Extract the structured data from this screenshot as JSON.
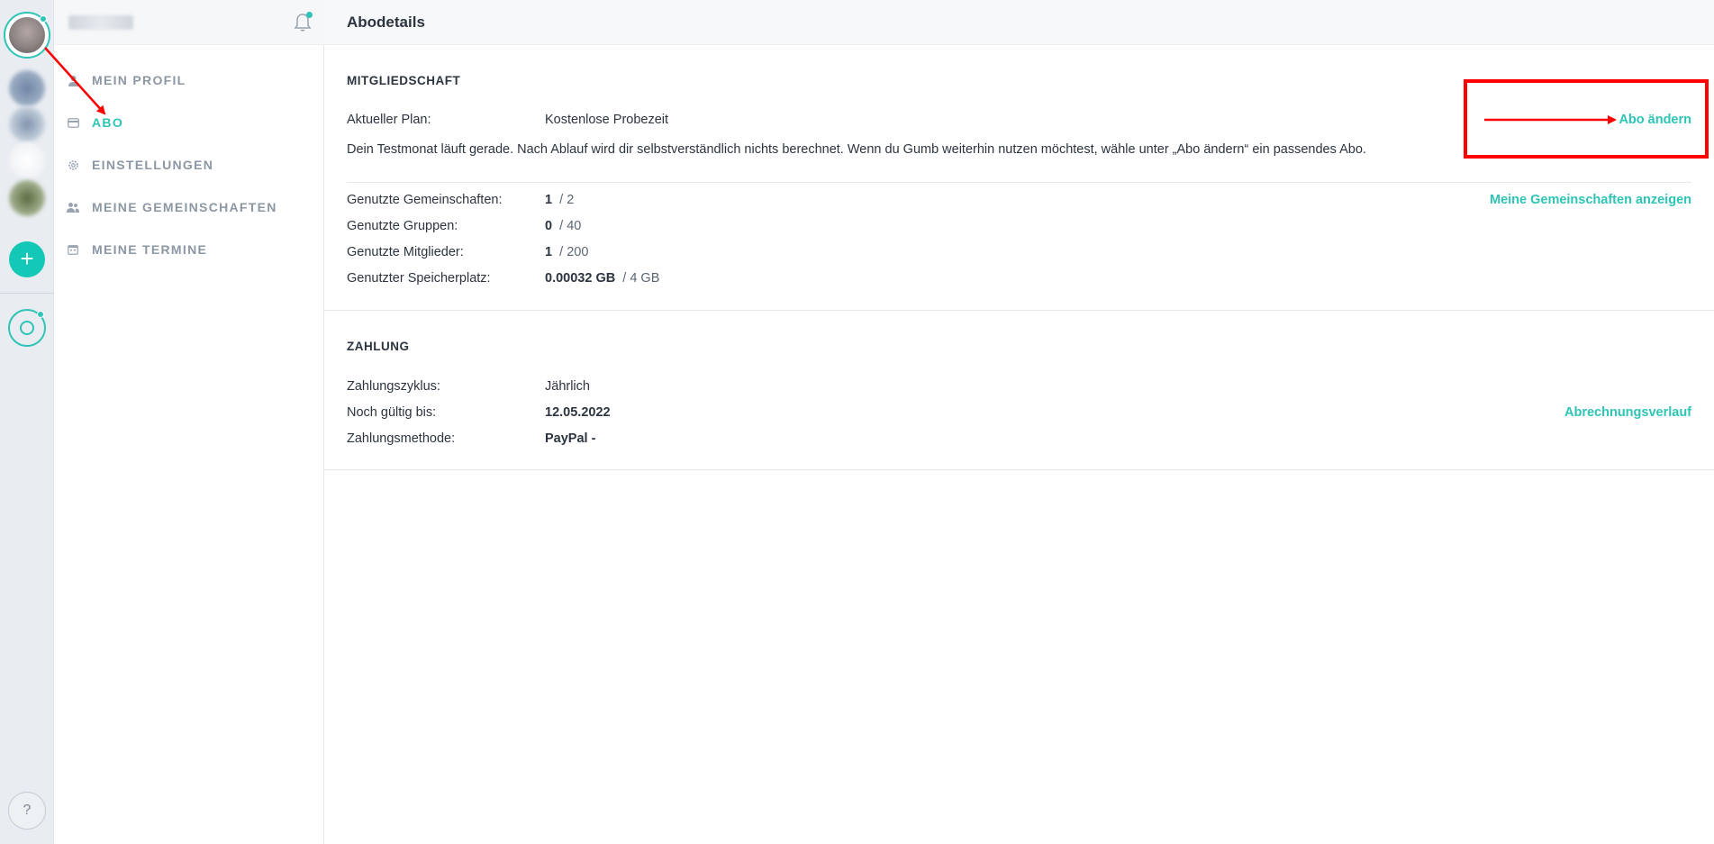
{
  "page": {
    "title": "Abodetails"
  },
  "rail": {
    "add_label": "+",
    "help_label": "?"
  },
  "sidebar": {
    "items": [
      {
        "label": "MEIN PROFIL",
        "icon": "person-icon"
      },
      {
        "label": "ABO",
        "icon": "credit-card-icon",
        "active": true
      },
      {
        "label": "EINSTELLUNGEN",
        "icon": "gear-icon"
      },
      {
        "label": "MEINE GEMEINSCHAFTEN",
        "icon": "people-icon"
      },
      {
        "label": "MEINE TERMINE",
        "icon": "calendar-icon"
      }
    ]
  },
  "membership": {
    "section_title": "MITGLIEDSCHAFT",
    "plan_label": "Aktueller Plan:",
    "plan_value": "Kostenlose Probezeit",
    "change_link": "Abo ändern",
    "description": "Dein Testmonat läuft gerade. Nach Ablauf wird dir selbstverständlich nichts berechnet. Wenn du Gumb weiterhin nutzen möchtest, wähle unter „Abo ändern“ ein passendes Abo.",
    "show_communities_link": "Meine Gemeinschaften anzeigen",
    "usage": [
      {
        "label": "Genutzte Gemeinschaften:",
        "used": "1",
        "limit": "/ 2"
      },
      {
        "label": "Genutzte Gruppen:",
        "used": "0",
        "limit": "/ 40"
      },
      {
        "label": "Genutzte Mitglieder:",
        "used": "1",
        "limit": "/ 200"
      },
      {
        "label": "Genutzter Speicherplatz:",
        "used": "0.00032 GB",
        "limit": "/ 4 GB"
      }
    ]
  },
  "payment": {
    "section_title": "ZAHLUNG",
    "cycle_label": "Zahlungszyklus:",
    "cycle_value": "Jährlich",
    "valid_label": "Noch gültig bis:",
    "valid_value": "12.05.2022",
    "method_label": "Zahlungsmethode:",
    "method_value": "PayPal -",
    "history_link": "Abrechnungsverlauf"
  },
  "colors": {
    "accent": "#2ec4b6",
    "annotation": "#ff0000",
    "text": "#2c3440",
    "muted": "#8c97a4"
  }
}
